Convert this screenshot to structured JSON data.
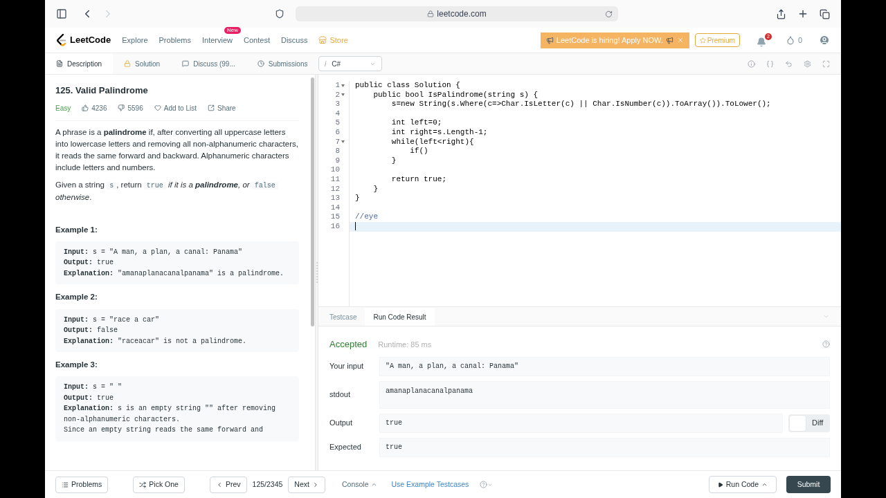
{
  "browser": {
    "url": "leetcode.com"
  },
  "nav": {
    "brand": "LeetCode",
    "items": [
      {
        "label": "Explore",
        "kind": "plain"
      },
      {
        "label": "Problems",
        "kind": "plain"
      },
      {
        "label": "Interview",
        "badge": "New",
        "kind": "plain"
      },
      {
        "label": "Contest",
        "kind": "plain"
      },
      {
        "label": "Discuss",
        "kind": "plain"
      },
      {
        "label": "Store",
        "kind": "store"
      }
    ],
    "banner": "LeetCode is hiring! Apply NOW.",
    "premium": "Premium",
    "notifications": "2",
    "coins": "0"
  },
  "tabs": [
    {
      "label": "Description",
      "selected": true
    },
    {
      "label": "Solution",
      "selected": false
    },
    {
      "label": "Discuss (99...",
      "selected": false
    },
    {
      "label": "Submissions",
      "selected": false
    }
  ],
  "language": {
    "hint": "i",
    "value": "C#"
  },
  "problem": {
    "title": "125. Valid Palindrome",
    "difficulty": "Easy",
    "likes": "4236",
    "dislikes": "5596",
    "add_to_list": "Add to List",
    "share": "Share",
    "paragraphs": [
      [
        {
          "kind": "text",
          "text": "A phrase is a **palindrome** if, after converting all uppercase letters into lowercase letters and removing all non-alphanumeric characters, it reads the same forward and backward. Alphanumeric characters include letters and numbers."
        }
      ],
      [
        {
          "kind": "text",
          "text": "Given a string "
        },
        {
          "kind": "code",
          "text": "s"
        },
        {
          "kind": "text",
          "text": ", return "
        },
        {
          "kind": "code",
          "text": "true"
        },
        {
          "kind": "italic",
          "text": " if it is a "
        },
        {
          "kind": "bold_italic",
          "text": "palindrome"
        },
        {
          "kind": "italic",
          "text": ", or "
        },
        {
          "kind": "code",
          "text": "false"
        },
        {
          "kind": "italic",
          "text": " otherwise"
        },
        {
          "kind": "text",
          "text": "."
        }
      ]
    ],
    "examples": [
      {
        "title": "Example 1:",
        "lines": [
          {
            "label": "Input:",
            "value": " s = \"A man, a plan, a canal: Panama\""
          },
          {
            "label": "Output:",
            "value": " true"
          },
          {
            "label": "Explanation:",
            "value": " \"amanaplanacanalpanama\" is a palindrome."
          }
        ]
      },
      {
        "title": "Example 2:",
        "lines": [
          {
            "label": "Input:",
            "value": " s = \"race a car\""
          },
          {
            "label": "Output:",
            "value": " false"
          },
          {
            "label": "Explanation:",
            "value": " \"raceacar\" is not a palindrome."
          }
        ]
      },
      {
        "title": "Example 3:",
        "lines": [
          {
            "label": "Input:",
            "value": " s = \" \""
          },
          {
            "label": "Output:",
            "value": " true"
          },
          {
            "label": "Explanation:",
            "value": " s is an empty string \"\" after removing non-alphanumeric characters."
          },
          {
            "value": "Since an empty string reads the same forward and"
          }
        ]
      }
    ]
  },
  "editor": {
    "lines": [
      {
        "number": "1",
        "text": "public class Solution {",
        "fold": true,
        "kind": "code"
      },
      {
        "number": "2",
        "text": "    public bool IsPalindrome(string s) {",
        "fold": true,
        "kind": "code"
      },
      {
        "number": "3",
        "text": "        s=new String(s.Where(c=>Char.IsLetter(c) || Char.IsNumber(c)).ToArray()).ToLower();",
        "fold": false,
        "kind": "code"
      },
      {
        "number": "4",
        "fold": false,
        "kind": "code"
      },
      {
        "number": "5",
        "text": "        int left=0;",
        "fold": false,
        "kind": "code"
      },
      {
        "number": "6",
        "text": "        int right=s.Length-1;",
        "fold": false,
        "kind": "code"
      },
      {
        "number": "7",
        "text": "        while(left<right){",
        "fold": true,
        "kind": "code"
      },
      {
        "number": "8",
        "text": "            if()",
        "fold": false,
        "kind": "code"
      },
      {
        "number": "9",
        "text": "        }",
        "fold": false,
        "kind": "code"
      },
      {
        "number": "10",
        "fold": false,
        "kind": "code"
      },
      {
        "number": "11",
        "text": "        return true;",
        "fold": false,
        "kind": "code"
      },
      {
        "number": "12",
        "text": "    }",
        "fold": false,
        "kind": "code"
      },
      {
        "number": "13",
        "text": "}",
        "fold": false,
        "kind": "code"
      },
      {
        "number": "14",
        "fold": false,
        "kind": "code"
      },
      {
        "number": "15",
        "text": "//eye",
        "fold": false,
        "kind": "comment"
      },
      {
        "number": "16",
        "fold": false,
        "kind": "current"
      }
    ]
  },
  "result_tabs": [
    {
      "label": "Testcase",
      "selected": false
    },
    {
      "label": "Run Code Result",
      "selected": true
    }
  ],
  "result": {
    "status": "Accepted",
    "runtime": "Runtime: 85 ms",
    "rows": [
      {
        "label": "Your input",
        "value": "\"A man, a plan, a canal: Panama\"",
        "kind": "plain"
      },
      {
        "label": "stdout",
        "value": "amanaplanacanalpanama",
        "kind": "tall"
      },
      {
        "label": "Output",
        "value": "true",
        "kind": "diff",
        "diff_label": "Diff"
      },
      {
        "label": "Expected",
        "value": "true",
        "kind": "plain"
      }
    ]
  },
  "footer": {
    "problems": "Problems",
    "pick_one": "Pick One",
    "prev": "Prev",
    "page": "125/2345",
    "next": "Next",
    "console": "Console",
    "example_testcases": "Use Example Testcases",
    "run_code": "Run Code",
    "submit": "Submit"
  }
}
